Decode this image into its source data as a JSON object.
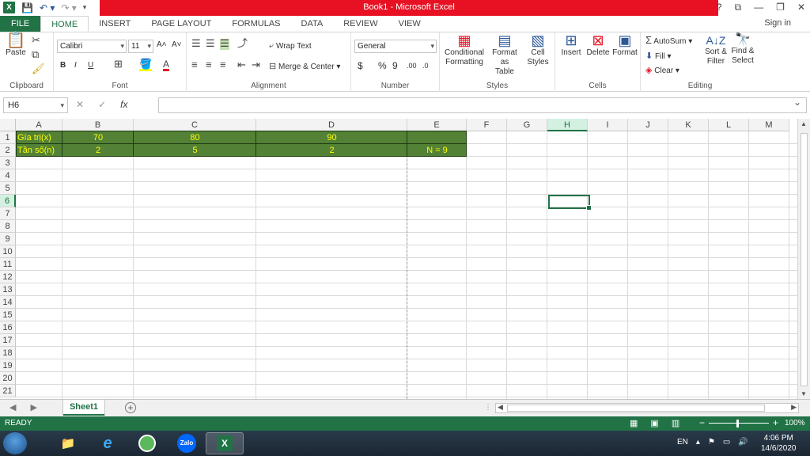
{
  "window": {
    "title": "Book1 - Microsoft Excel",
    "help": "?",
    "controls": [
      "⧉",
      "—",
      "❐",
      "✕"
    ]
  },
  "tabs": {
    "file": "FILE",
    "items": [
      "HOME",
      "INSERT",
      "PAGE LAYOUT",
      "FORMULAS",
      "DATA",
      "REVIEW",
      "VIEW"
    ],
    "signin": "Sign in"
  },
  "ribbon": {
    "clipboard": {
      "paste": "Paste",
      "label": "Clipboard"
    },
    "font": {
      "name": "Calibri",
      "size": "11",
      "bold": "B",
      "italic": "I",
      "underline": "U",
      "grow": "A˄",
      "shrink": "A˅",
      "label": "Font"
    },
    "alignment": {
      "wrap": "Wrap Text",
      "merge": "Merge & Center",
      "label": "Alignment"
    },
    "number": {
      "format": "General",
      "currency": "$",
      "percent": "%",
      "comma": "9",
      "inc": ".00",
      "dec": ".0",
      "label": "Number"
    },
    "styles": {
      "cond_1": "Conditional",
      "cond_2": "Formatting",
      "fmt_1": "Format as",
      "fmt_2": "Table",
      "cell_1": "Cell",
      "cell_2": "Styles",
      "label": "Styles"
    },
    "cells": {
      "insert": "Insert",
      "delete": "Delete",
      "format": "Format",
      "label": "Cells"
    },
    "editing": {
      "autosum": "AutoSum",
      "fill": "Fill",
      "clear": "Clear",
      "sort_1": "Sort &",
      "sort_2": "Filter",
      "find_1": "Find &",
      "find_2": "Select",
      "label": "Editing"
    }
  },
  "formula_bar": {
    "name_box": "H6",
    "fx": "fx",
    "value": ""
  },
  "grid": {
    "columns": [
      "A",
      "B",
      "C",
      "D",
      "E",
      "F",
      "G",
      "H",
      "I",
      "J",
      "K",
      "L",
      "M"
    ],
    "rows": [
      "1",
      "2",
      "3",
      "4",
      "5",
      "6",
      "7",
      "8",
      "9",
      "10",
      "11",
      "12",
      "13",
      "14",
      "15",
      "16",
      "17",
      "18",
      "19",
      "20",
      "21"
    ],
    "cells": {
      "A1": "Gía trị(x)",
      "B1": "70",
      "C1": "80",
      "D1": "90",
      "A2": "Tần số(n)",
      "B2": "2",
      "C2": "5",
      "D2": "2",
      "E2": "N = 9"
    },
    "fill_color": "#538135",
    "text_color": "#ffff00"
  },
  "sheets": {
    "tabs": [
      "Sheet1"
    ],
    "add": "+"
  },
  "status": {
    "ready": "READY",
    "zoom": "100%"
  },
  "taskbar": {
    "lang": "EN",
    "time": "4:06 PM",
    "date": "14/6/2020",
    "zalo": "Zalo"
  }
}
